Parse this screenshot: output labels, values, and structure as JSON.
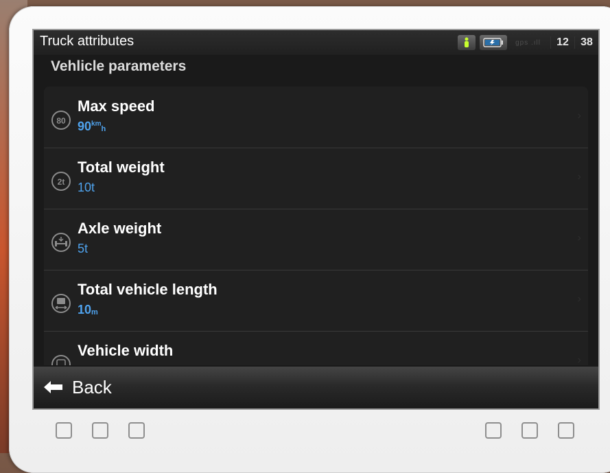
{
  "window": {
    "title": "Truck attributes"
  },
  "status": {
    "gps_label": "gps",
    "clock_hours": "12",
    "clock_minutes": "38"
  },
  "page": {
    "title": "Vehlicle parameters"
  },
  "rows": [
    {
      "label": "Max speed",
      "value": "90",
      "unit": "km",
      "unit_denominator": "h",
      "icon_text": "80",
      "icon": "speed-limit-icon"
    },
    {
      "label": "Total weight",
      "value": "10t",
      "icon_text": "2t",
      "icon": "weight-limit-icon"
    },
    {
      "label": "Axle weight",
      "value": "5t",
      "icon": "axle-weight-icon"
    },
    {
      "label": "Total vehicle length",
      "value": "10",
      "unit": "m",
      "icon": "vehicle-length-icon"
    },
    {
      "label": "Vehicle width",
      "icon": "vehicle-width-icon"
    }
  ],
  "footer": {
    "back_label": "Back"
  },
  "colors": {
    "value_blue": "#4fa3ee",
    "screen_bg": "#1a1a1a",
    "bezel": "#f4f4f4"
  }
}
